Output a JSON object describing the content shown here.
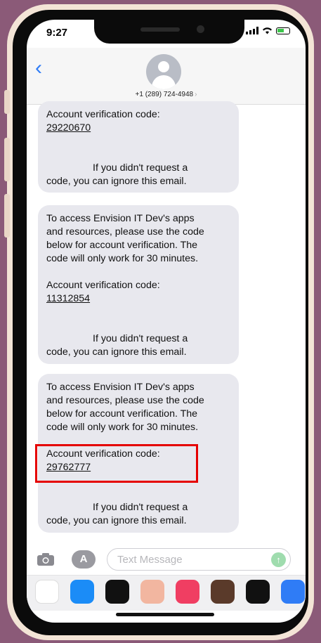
{
  "status_bar": {
    "time": "9:27"
  },
  "header": {
    "back": "‹",
    "contact_number": "+1 (289) 724-4948",
    "contact_chevron": "›"
  },
  "messages": [
    {
      "lines": [
        {
          "text": "Account verification code:",
          "kind": "text"
        },
        {
          "text": "29220670",
          "kind": "code"
        },
        {
          "text": "",
          "kind": "blank"
        },
        {
          "text": "",
          "kind": "blank"
        },
        {
          "text": "If you didn't request a",
          "kind": "indent"
        },
        {
          "text": "code, you can ignore this email.",
          "kind": "text"
        }
      ]
    },
    {
      "lines": [
        {
          "text": "To access Envision IT Dev's apps",
          "kind": "text"
        },
        {
          "text": "and resources, please use the code",
          "kind": "text"
        },
        {
          "text": "below for account verification. The",
          "kind": "text"
        },
        {
          "text": "code will only work for 30 minutes.",
          "kind": "text"
        },
        {
          "text": "",
          "kind": "blank"
        },
        {
          "text": "Account verification code:",
          "kind": "text"
        },
        {
          "text": "11312854",
          "kind": "code"
        },
        {
          "text": "",
          "kind": "blank"
        },
        {
          "text": "",
          "kind": "blank"
        },
        {
          "text": "If you didn't request a",
          "kind": "indent"
        },
        {
          "text": "code, you can ignore this email.",
          "kind": "text"
        }
      ]
    },
    {
      "lines": [
        {
          "text": "To access Envision IT Dev's apps",
          "kind": "text"
        },
        {
          "text": "and resources, please use the code",
          "kind": "text"
        },
        {
          "text": "below for account verification. The",
          "kind": "text"
        },
        {
          "text": "code will only work for 30 minutes.",
          "kind": "text"
        },
        {
          "text": "",
          "kind": "blank"
        },
        {
          "text": "Account verification code:",
          "kind": "text"
        },
        {
          "text": "29762777",
          "kind": "code"
        },
        {
          "text": "",
          "kind": "blank"
        },
        {
          "text": "",
          "kind": "blank"
        },
        {
          "text": "If you didn't request a",
          "kind": "indent"
        },
        {
          "text": "code, you can ignore this email.",
          "kind": "text"
        }
      ]
    }
  ],
  "input": {
    "placeholder": "Text Message",
    "apps_label": "A",
    "send": "↑"
  },
  "app_drawer": {
    "apps": [
      {
        "name": "photos",
        "color": "#ffffff"
      },
      {
        "name": "app-store",
        "color": "#1b8cf7"
      },
      {
        "name": "fitness",
        "color": "#111111"
      },
      {
        "name": "memoji",
        "color": "#f2b6a0"
      },
      {
        "name": "search-images",
        "color": "#f03e62"
      },
      {
        "name": "memoji-2",
        "color": "#5a3a2a"
      },
      {
        "name": "digital-touch",
        "color": "#111111"
      },
      {
        "name": "more",
        "color": "#2f7cf6"
      }
    ]
  },
  "colors": {
    "accent": "#2f7cf6",
    "highlight": "#e50000",
    "bubble": "#e8e8ee"
  }
}
